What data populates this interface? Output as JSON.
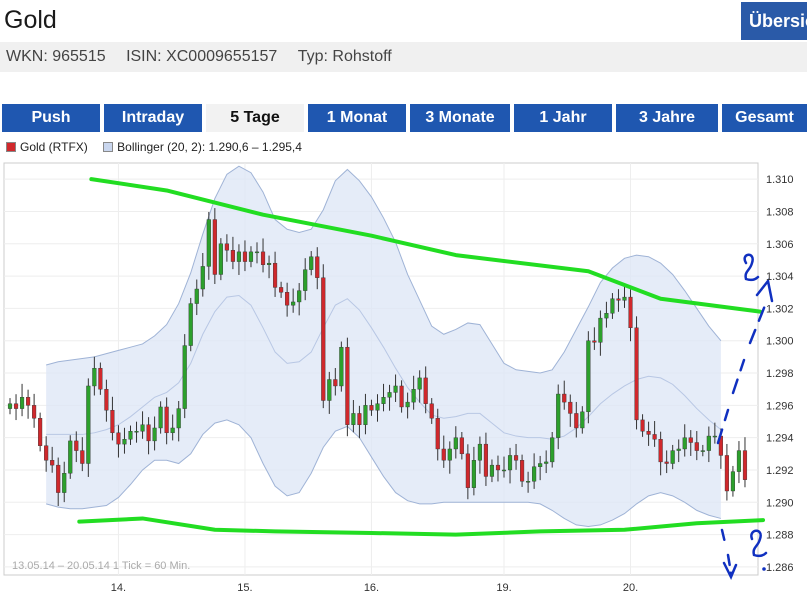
{
  "header": {
    "title": "Gold",
    "overview_button": "Übersicht"
  },
  "meta": {
    "wkn": "WKN: 965515",
    "isin": "ISIN: XC0009655157",
    "typ": "Typ: Rohstoff"
  },
  "tabs": [
    {
      "label": "Push",
      "active": false
    },
    {
      "label": "Intraday",
      "active": false
    },
    {
      "label": "5 Tage",
      "active": true
    },
    {
      "label": "1 Monat",
      "active": false
    },
    {
      "label": "3 Monate",
      "active": false
    },
    {
      "label": "1 Jahr",
      "active": false
    },
    {
      "label": "3 Jahre",
      "active": false
    },
    {
      "label": "Gesamt",
      "active": false
    }
  ],
  "colors": {
    "tab": "#1f57b0",
    "up": "#2ca02c",
    "down": "#d0282c",
    "band_fill": "#dce6f5",
    "band_line": "#9fb3d6",
    "trend": "#22dd22",
    "annotation": "#1030c0"
  },
  "chart_data": {
    "type": "candlestick",
    "legend": [
      "Gold (RTFX)",
      "Bollinger (20, 2): 1.290,6 – 1.295,4"
    ],
    "footer": "13.05.14 – 20.05.14   1 Tick = 60 Min.",
    "x_ticks": [
      "14.",
      "15.",
      "16.",
      "19.",
      "20."
    ],
    "y_ticks": [
      "1.286",
      "1.288",
      "1.290",
      "1.292",
      "1.294",
      "1.296",
      "1.298",
      "1.300",
      "1.302",
      "1.304",
      "1.306",
      "1.308",
      "1.310"
    ],
    "ylim": [
      1285.5,
      1311
    ],
    "y_tick_values": [
      1286,
      1288,
      1290,
      1292,
      1294,
      1296,
      1298,
      1300,
      1302,
      1304,
      1306,
      1308,
      1310
    ],
    "x_tick_index": [
      18,
      39,
      60,
      82,
      103
    ],
    "close": [
      1296.1,
      1295.8,
      1296.5,
      1296.0,
      1295.2,
      1293.5,
      1292.6,
      1292.3,
      1290.6,
      1291.8,
      1293.8,
      1293.2,
      1292.4,
      1297.2,
      1298.3,
      1297.0,
      1295.7,
      1294.3,
      1293.6,
      1293.9,
      1294.4,
      1294.4,
      1294.8,
      1293.8,
      1294.6,
      1295.9,
      1294.3,
      1294.6,
      1295.8,
      1299.7,
      1302.3,
      1303.2,
      1304.6,
      1307.5,
      1304.1,
      1306.0,
      1305.6,
      1304.9,
      1305.5,
      1304.9,
      1305.5,
      1305.5,
      1304.7,
      1304.8,
      1303.3,
      1303.0,
      1302.2,
      1302.4,
      1303.1,
      1304.4,
      1305.2,
      1303.9,
      1296.3,
      1297.6,
      1297.2,
      1299.6,
      1294.8,
      1295.5,
      1294.8,
      1296.0,
      1295.7,
      1296.1,
      1296.5,
      1296.8,
      1297.2,
      1295.9,
      1296.2,
      1297.0,
      1297.7,
      1296.1,
      1295.2,
      1293.3,
      1292.6,
      1293.3,
      1294.0,
      1293.0,
      1290.9,
      1292.6,
      1293.6,
      1291.6,
      1292.3,
      1292.0,
      1292.0,
      1292.9,
      1292.6,
      1291.3,
      1291.3,
      1292.2,
      1292.4,
      1292.5,
      1294.0,
      1296.7,
      1296.2,
      1295.5,
      1294.6,
      1295.6,
      1300.0,
      1299.9,
      1301.4,
      1301.7,
      1302.6,
      1302.5,
      1302.7,
      1300.8,
      1295.1,
      1294.4,
      1294.2,
      1293.9,
      1292.5,
      1292.4,
      1293.2,
      1293.3,
      1294.0,
      1293.7,
      1293.2,
      1293.2,
      1294.1,
      1294.1,
      1292.9,
      1290.7,
      1291.9,
      1293.2,
      1291.4
    ],
    "series": [
      {
        "name": "Gold (RTFX)"
      },
      {
        "name": "Bollinger (20, 2)"
      }
    ],
    "bollinger_upper": [
      1298.5,
      1298.7,
      1298.8,
      1298.9,
      1299.0,
      1299.2,
      1299.4,
      1299.6,
      1299.8,
      1300.3,
      1301.0,
      1302.3,
      1304.2,
      1306.6,
      1308.8,
      1310.3,
      1310.8,
      1310.4,
      1309.2,
      1307.5,
      1306.9,
      1306.7,
      1306.9,
      1308.1,
      1309.9,
      1310.6,
      1309.9,
      1308.9,
      1307.6,
      1306.1,
      1304.1,
      1302.5,
      1300.9,
      1300.4,
      1300.7,
      1301.1,
      1301.0,
      1299.8,
      1298.6,
      1298.2,
      1298.1,
      1298.0,
      1298.2,
      1299.3,
      1300.7,
      1302.1,
      1303.6,
      1304.5,
      1305.1,
      1305.3,
      1305.2,
      1304.8,
      1304.1,
      1303.1,
      1302.0,
      1300.9,
      1300.0
    ],
    "bollinger_lower": [
      1289.9,
      1289.7,
      1289.6,
      1289.6,
      1289.7,
      1289.8,
      1290.3,
      1291.1,
      1292.0,
      1292.6,
      1292.6,
      1292.4,
      1293.0,
      1294.2,
      1294.9,
      1295.1,
      1294.8,
      1294.0,
      1292.4,
      1291.0,
      1290.4,
      1290.6,
      1291.8,
      1293.4,
      1294.4,
      1294.7,
      1294.0,
      1292.8,
      1291.6,
      1290.6,
      1290.1,
      1289.9,
      1289.9,
      1290.0,
      1290.0,
      1290.0,
      1290.0,
      1290.0,
      1290.0,
      1290.0,
      1290.0,
      1289.9,
      1289.5,
      1289.0,
      1288.6,
      1288.5,
      1288.6,
      1288.9,
      1289.3,
      1289.9,
      1290.4,
      1290.6,
      1290.4,
      1290.0,
      1289.5,
      1289.2,
      1289.0
    ],
    "bollinger_middle": [
      1294.2,
      1294.2,
      1294.2,
      1294.2,
      1294.3,
      1294.5,
      1294.8,
      1295.3,
      1295.9,
      1296.5,
      1296.8,
      1297.4,
      1298.6,
      1300.4,
      1301.8,
      1302.7,
      1302.8,
      1302.2,
      1300.8,
      1299.3,
      1298.6,
      1298.7,
      1299.3,
      1300.8,
      1302.2,
      1302.6,
      1301.9,
      1300.8,
      1299.6,
      1298.3,
      1297.1,
      1296.2,
      1295.4,
      1295.2,
      1295.3,
      1295.5,
      1295.5,
      1294.9,
      1294.3,
      1294.1,
      1294.0,
      1294.0,
      1293.9,
      1294.1,
      1294.6,
      1295.3,
      1296.1,
      1296.7,
      1297.2,
      1297.6,
      1297.8,
      1297.7,
      1297.3,
      1296.6,
      1295.8,
      1295.1,
      1294.5
    ],
    "bollinger_index": [
      0,
      2,
      4,
      6,
      8,
      10,
      12,
      14,
      16,
      18,
      20,
      22,
      24,
      26,
      28,
      30,
      32,
      34,
      36,
      38,
      40,
      42,
      44,
      46,
      48,
      50,
      52,
      54,
      56,
      58,
      60,
      62,
      64,
      66,
      68,
      70,
      72,
      74,
      76,
      78,
      80,
      82,
      84,
      86,
      88,
      90,
      92,
      94,
      96,
      98,
      100,
      102,
      104,
      106,
      108,
      110,
      112
    ],
    "trendlines": [
      {
        "points": [
          [
            13.5,
            1310.0
          ],
          [
            26,
            1309.3
          ],
          [
            42,
            1307.8
          ],
          [
            60,
            1306.5
          ],
          [
            74,
            1305.3
          ],
          [
            96,
            1304.3
          ],
          [
            108,
            1302.6
          ],
          [
            124.5,
            1301.8
          ]
        ]
      },
      {
        "points": [
          [
            11.5,
            1288.8
          ],
          [
            22,
            1289.0
          ],
          [
            34,
            1288.3
          ],
          [
            44,
            1288.2
          ],
          [
            60,
            1288.1
          ],
          [
            74,
            1288.0
          ],
          [
            88,
            1288.2
          ],
          [
            102,
            1288.3
          ],
          [
            114,
            1288.7
          ],
          [
            125,
            1288.9
          ]
        ]
      }
    ]
  }
}
